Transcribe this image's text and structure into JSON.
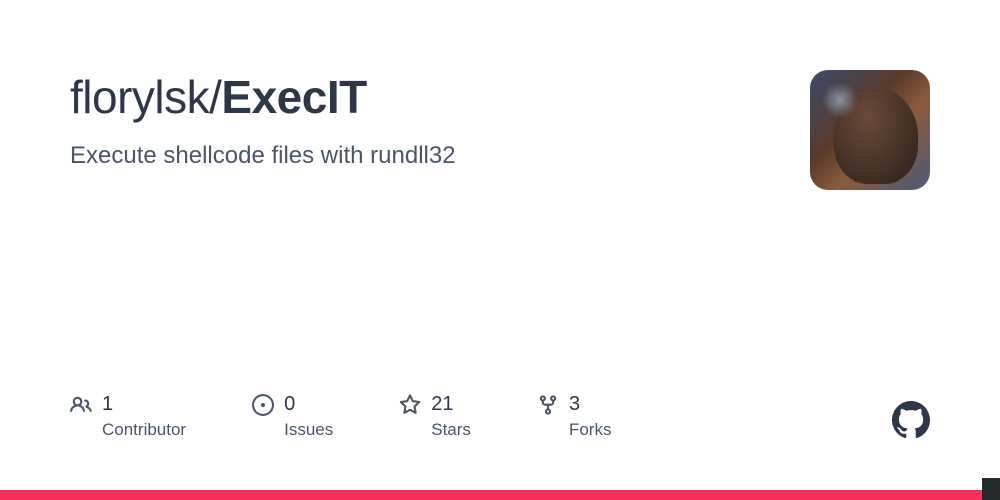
{
  "repo": {
    "owner": "florylsk",
    "name": "ExecIT",
    "description": "Execute shellcode files with rundll32"
  },
  "stats": {
    "contributors": {
      "value": "1",
      "label": "Contributor"
    },
    "issues": {
      "value": "0",
      "label": "Issues"
    },
    "stars": {
      "value": "21",
      "label": "Stars"
    },
    "forks": {
      "value": "3",
      "label": "Forks"
    }
  }
}
